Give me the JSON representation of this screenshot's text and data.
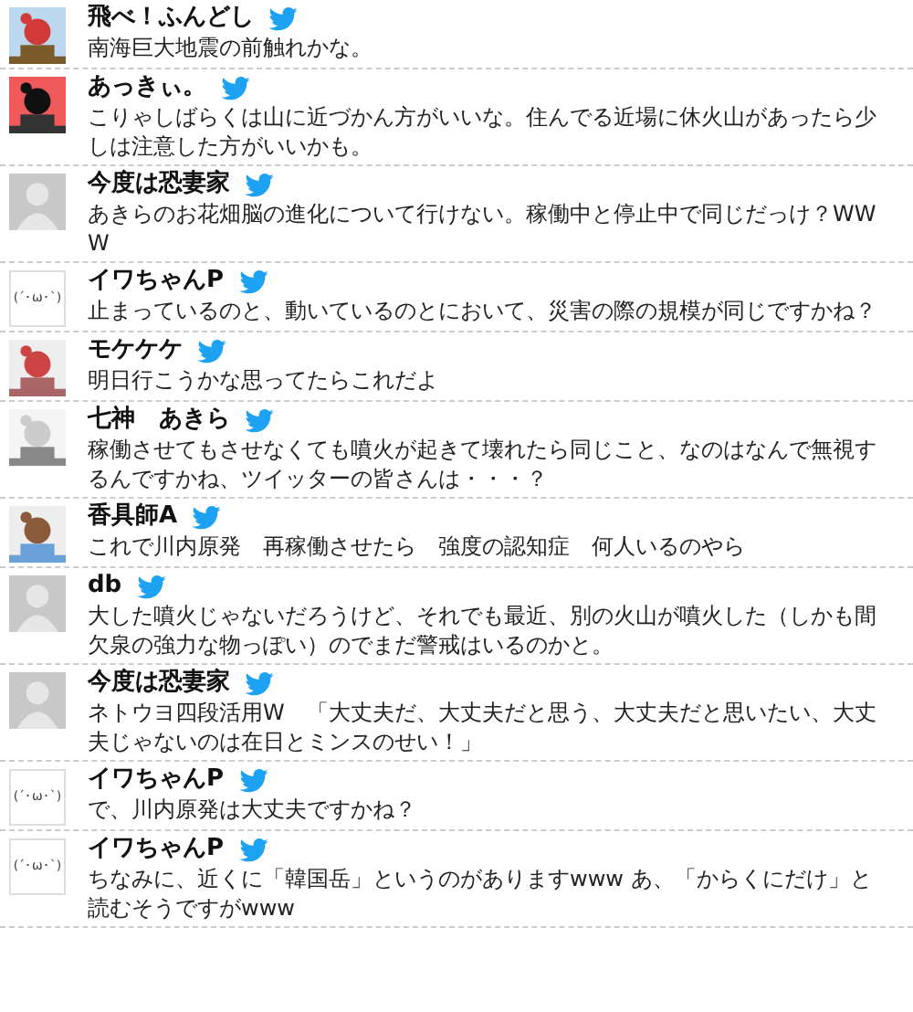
{
  "tweets": [
    {
      "name": "飛べ！ふんどし",
      "text": "南海巨大地震の前触れかな。"
    },
    {
      "name": "あっきぃ。",
      "text": "こりゃしばらくは山に近づかん方がいいな。住んでる近場に休火山があったら少しは注意した方がいいかも。"
    },
    {
      "avatar": {
        "kind": "noimage"
      },
      "name": "今度は恐妻家",
      "text": "あきらのお花畑脳の進化について行けない。稼働中と停止中で同じだっけ？WWW"
    },
    {
      "avatar": {
        "kind": "emoticon",
        "text": "(´･ω･`)"
      },
      "name": "イワちゃんP",
      "text": "止まっているのと、動いているのとにおいて、災害の際の規模が同じですかね？"
    },
    {
      "name": "モケケケ",
      "text": "明日行こうかな思ってたらこれだよ"
    },
    {
      "name": "七神　あきら",
      "text": "稼働させてもさせなくても噴火が起きて壊れたら同じこと、なのはなんで無視するんですかね、ツイッターの皆さんは・・・？"
    },
    {
      "name": "香具師A",
      "text": "これで川内原発　再稼働させたら　強度の認知症　何人いるのやら"
    },
    {
      "avatar": {
        "kind": "noimage"
      },
      "name": "db",
      "text": "大した噴火じゃないだろうけど、それでも最近、別の火山が噴火した（しかも間欠泉の強力な物っぽい）のでまだ警戒はいるのかと。"
    },
    {
      "avatar": {
        "kind": "noimage"
      },
      "name": "今度は恐妻家",
      "text": "ネトウヨ四段活用W　「大丈夫だ、大丈夫だと思う、大丈夫だと思いたい、大丈夫じゃないのは在日とミンスのせい！」"
    },
    {
      "avatar": {
        "kind": "emoticon",
        "text": "(´･ω･`)"
      },
      "name": "イワちゃんP",
      "text": "で、川内原発は大丈夫ですかね？"
    },
    {
      "avatar": {
        "kind": "emoticon",
        "text": "(´･ω･`)"
      },
      "name": "イワちゃんP",
      "text": "ちなみに、近くに「韓国岳」というのがありますwww  あ、「からくにだけ」と読むそうですがwww"
    }
  ]
}
